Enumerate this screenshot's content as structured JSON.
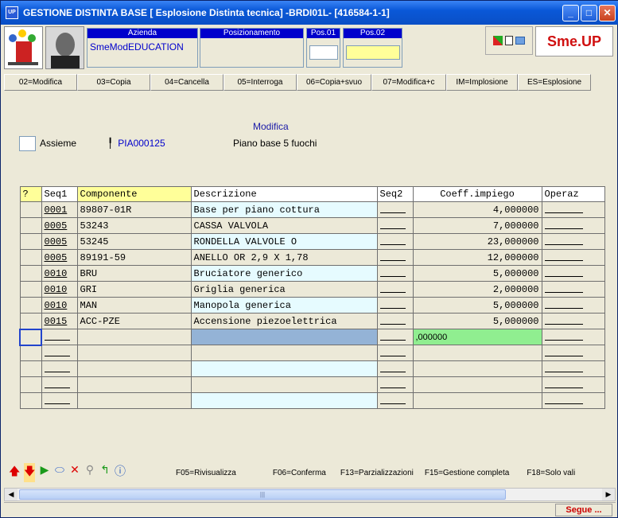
{
  "window": {
    "title": "GESTIONE DISTINTA BASE [ Esplosione Distinta tecnica] -BRDI01L- [416584-1-1]",
    "app_icon": "UP"
  },
  "header": {
    "azienda_label": "Azienda",
    "azienda_value": "SmeModEDUCATION",
    "posizionamento_label": "Posizionamento",
    "pos01_label": "Pos.01",
    "pos02_label": "Pos.02",
    "brand": "Sme.UP"
  },
  "toolbar": {
    "buttons": [
      "02=Modifica",
      "03=Copia",
      "04=Cancella",
      "05=Interroga",
      "06=Copia+svuo",
      "07=Modifica+c",
      "IM=Implosione",
      "ES=Esplosione"
    ]
  },
  "form": {
    "mode": "Modifica",
    "assieme_label": "Assieme",
    "code": "PIA000125",
    "description": "Piano base 5 fuochi"
  },
  "grid": {
    "columns": [
      "?",
      "Seq1",
      "Componente",
      "Descrizione",
      "Seq2",
      "Coeff.impiego",
      "Operaz"
    ],
    "rows": [
      {
        "seq1": "0001",
        "comp": "89807-01R",
        "desc": "Base per piano cottura",
        "coeff": "4,000000"
      },
      {
        "seq1": "0005",
        "comp": "53243",
        "desc": "CASSA VALVOLA",
        "coeff": "7,000000"
      },
      {
        "seq1": "0005",
        "comp": "53245",
        "desc": "RONDELLA VALVOLE O",
        "coeff": "23,000000"
      },
      {
        "seq1": "0005",
        "comp": "89191-59",
        "desc": "ANELLO OR 2,9 X 1,78",
        "coeff": "12,000000"
      },
      {
        "seq1": "0010",
        "comp": "BRU",
        "desc": "Bruciatore generico",
        "coeff": "5,000000"
      },
      {
        "seq1": "0010",
        "comp": "GRI",
        "desc": "Griglia generica",
        "coeff": "2,000000"
      },
      {
        "seq1": "0010",
        "comp": "MAN",
        "desc": "Manopola generica",
        "coeff": "5,000000"
      },
      {
        "seq1": "0015",
        "comp": "ACC-PZE",
        "desc": "Accensione piezoelettrica",
        "coeff": "5,000000"
      }
    ],
    "new_row_coeff": ",000000"
  },
  "function_keys": [
    "F05=Rivisualizza",
    "F06=Conferma",
    "F13=Parzializzazioni",
    "F15=Gestione completa",
    "F18=Solo vali"
  ],
  "status": {
    "segue": "Segue ..."
  }
}
